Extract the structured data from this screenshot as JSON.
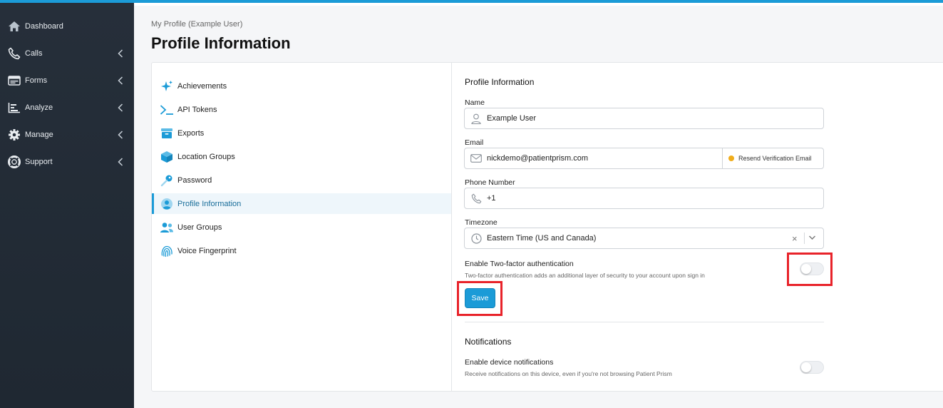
{
  "colors": {
    "accent": "#1b9bd7",
    "sidebar_bg": "#262f3a",
    "highlight": "#e8232a",
    "status_dot": "#f0ad1c"
  },
  "sidebar": {
    "items": [
      {
        "label": "Dashboard",
        "icon": "home-icon",
        "has_chevron": false
      },
      {
        "label": "Calls",
        "icon": "phone-icon",
        "has_chevron": true
      },
      {
        "label": "Forms",
        "icon": "form-icon",
        "has_chevron": true
      },
      {
        "label": "Analyze",
        "icon": "chart-icon",
        "has_chevron": true
      },
      {
        "label": "Manage",
        "icon": "gear-icon",
        "has_chevron": true
      },
      {
        "label": "Support",
        "icon": "lifebuoy-icon",
        "has_chevron": true
      }
    ]
  },
  "breadcrumb": "My Profile (Example User)",
  "page_title": "Profile Information",
  "settings_menu": {
    "items": [
      {
        "label": "Achievements",
        "icon": "sparkle-icon"
      },
      {
        "label": "API Tokens",
        "icon": "terminal-icon"
      },
      {
        "label": "Exports",
        "icon": "archive-icon"
      },
      {
        "label": "Location Groups",
        "icon": "cube-icon"
      },
      {
        "label": "Password",
        "icon": "key-icon"
      },
      {
        "label": "Profile Information",
        "icon": "user-circle-icon",
        "active": true
      },
      {
        "label": "User Groups",
        "icon": "users-icon"
      },
      {
        "label": "Voice Fingerprint",
        "icon": "fingerprint-icon"
      }
    ]
  },
  "profile": {
    "section_title": "Profile Information",
    "name_label": "Name",
    "name_value": "Example User",
    "email_label": "Email",
    "email_value": "nickdemo@patientprism.com",
    "resend_label": "Resend Verification Email",
    "phone_label": "Phone Number",
    "phone_value": "+1",
    "timezone_label": "Timezone",
    "timezone_value": "Eastern Time (US and Canada)",
    "timezone_clear": "×",
    "twofa_label": "Enable Two-factor authentication",
    "twofa_sub": "Two-factor authentication adds an additional layer of security to your account upon sign in",
    "twofa_enabled": false,
    "save_label": "Save"
  },
  "notifications": {
    "section_title": "Notifications",
    "device_label": "Enable device notifications",
    "device_sub": "Receive notifications on this device, even if you're not browsing Patient Prism",
    "device_enabled": false
  }
}
